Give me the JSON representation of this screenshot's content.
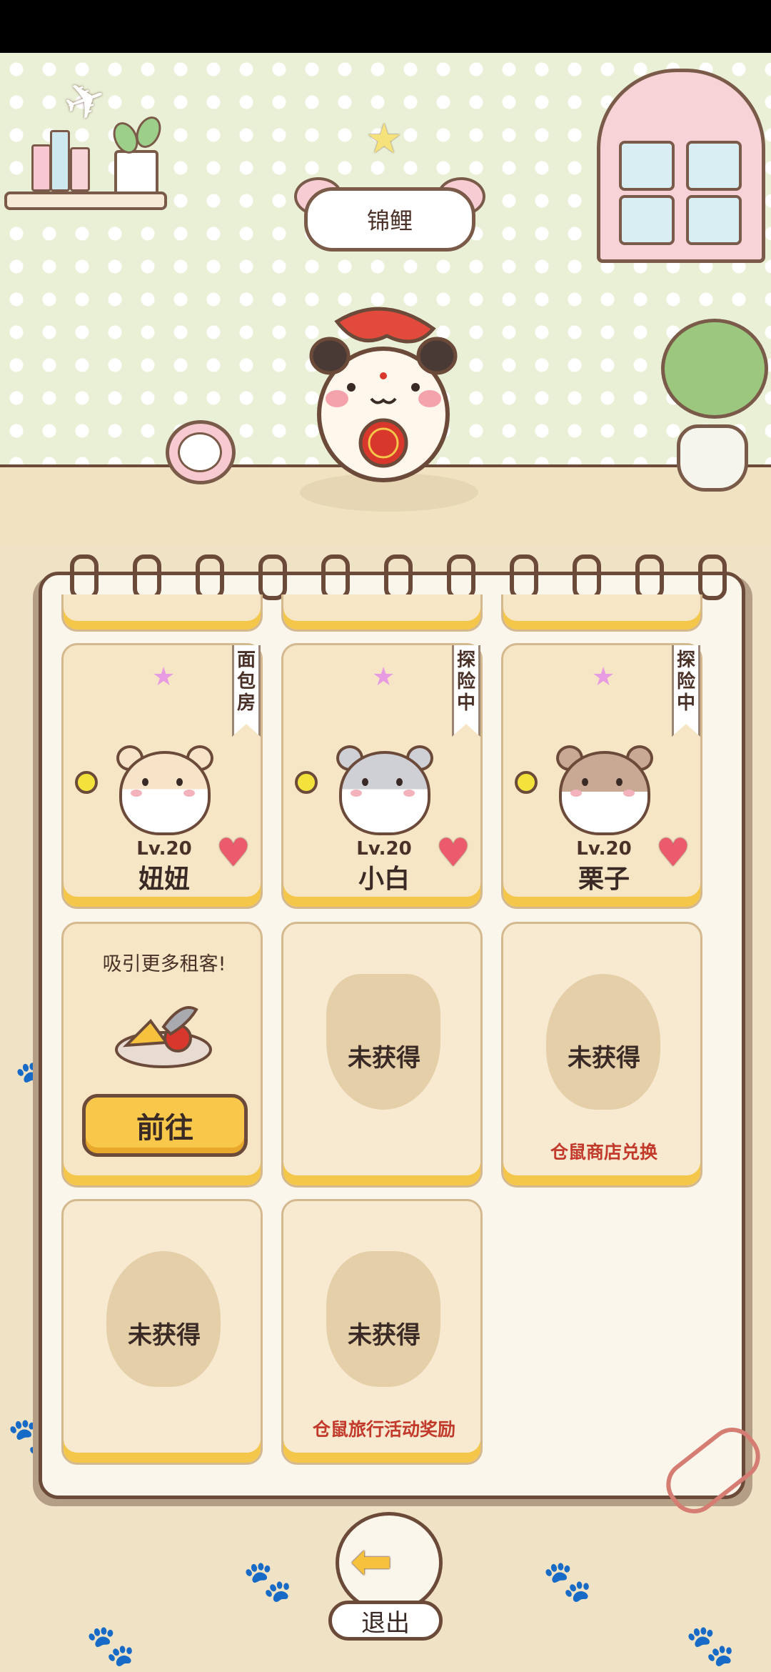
{
  "room": {
    "sign_label": "锦鲤",
    "colors": {
      "wall": "#e9f0d6",
      "floor": "#f1e2c2",
      "outline": "#6b4a3a"
    }
  },
  "hamsters": [
    {
      "level": "Lv.20",
      "name": "妞妞",
      "status": "面包房",
      "fur": "#f7e4c8"
    },
    {
      "level": "Lv.20",
      "name": "小白",
      "status": "探险中",
      "fur": "#cfcfd6"
    },
    {
      "level": "Lv.20",
      "name": "栗子",
      "status": "探险中",
      "fur": "#c9a894"
    }
  ],
  "recruit": {
    "text": "吸引更多租客!",
    "button": "前往"
  },
  "locked": [
    {
      "label": "未获得",
      "source": ""
    },
    {
      "label": "未获得",
      "source": "仓鼠商店兑换"
    },
    {
      "label": "未获得",
      "source": ""
    },
    {
      "label": "未获得",
      "source": "仓鼠旅行活动奖励"
    }
  ],
  "exit": {
    "label": "退出",
    "icon": "left-arrow-icon"
  },
  "accent": {
    "card_bottom": "#f4c64a",
    "heart": "#ec5a6d",
    "source_text": "#c23a2b"
  }
}
